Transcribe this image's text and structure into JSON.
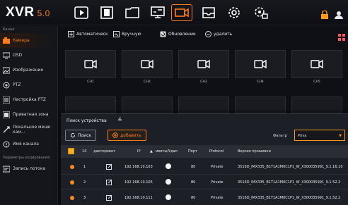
{
  "app": {
    "name": "XVR",
    "version": "5.0"
  },
  "top_icons": [
    "playback-icon",
    "video-file-icon",
    "folder-icon",
    "network-icon",
    "camera-icon",
    "storage-icon",
    "gear-icon",
    "system-settings-icon"
  ],
  "top_right_icons": [
    "lock-icon",
    "user-icon"
  ],
  "sidebar": {
    "sections": [
      {
        "header": "Канал",
        "items": [
          {
            "label": "Камера",
            "icon": "camera-icon",
            "active": true
          },
          {
            "label": "OSD",
            "icon": "monitor-icon"
          },
          {
            "label": "Изображение",
            "icon": "image-icon"
          },
          {
            "label": "PTZ",
            "icon": "ptz-icon"
          },
          {
            "label": "Настройка PTZ",
            "icon": "ptz-settings-icon"
          },
          {
            "label": "Приватная зона",
            "icon": "privacy-zone-icon"
          },
          {
            "label": "Локальное меню кам...",
            "icon": "local-menu-icon"
          },
          {
            "label": "Имя канала",
            "icon": "channel-name-icon"
          }
        ]
      },
      {
        "header": "Параметры кодирования",
        "items": [
          {
            "label": "Запись потока",
            "icon": "stream-record-icon"
          }
        ]
      }
    ]
  },
  "toolbar": {
    "auto_label": "Автоматическ",
    "manual_label": "Вручную",
    "refresh_label": "Обновление",
    "delete_label": "удалить"
  },
  "cameras": [
    {
      "label": "CH1"
    },
    {
      "label": "CH2"
    },
    {
      "label": "CH3"
    },
    {
      "label": "CH4"
    },
    {
      "label": "CH5"
    }
  ],
  "dialog": {
    "title": "Поиск устройства",
    "search_label": "Поиск",
    "add_label": "добавить",
    "filter_label": "Фильтр",
    "filter_value": "Priva",
    "columns": {
      "count": "14",
      "edit": "дактироват",
      "ip": "IP",
      "conn": "ивиты/Удал",
      "port": "Порт",
      "protocol": "Protocol",
      "firmware": "Версия прошивки"
    },
    "rows": [
      {
        "num": "1",
        "ip": "192.168.10.103",
        "port": "80",
        "protocol": "Private",
        "firmware": "3516D_IMX335_B1T1A1M0C1P1_W_X300035991_9.1.16.10"
      },
      {
        "num": "2",
        "ip": "192.168.10.105",
        "port": "80",
        "protocol": "Private",
        "firmware": "3516D_IMX335_B1T1A1M0C1P1_W_X300035991_9.1.52.2"
      },
      {
        "num": "3",
        "ip": "192.168.10.111",
        "port": "80",
        "protocol": "Private",
        "firmware": "3516D_IMX335_B1T1A1M0C1P1_W_X300035991_9.1.52.2"
      }
    ]
  },
  "colors": {
    "accent": "#ff7a1a",
    "background": "#0b0d12"
  }
}
